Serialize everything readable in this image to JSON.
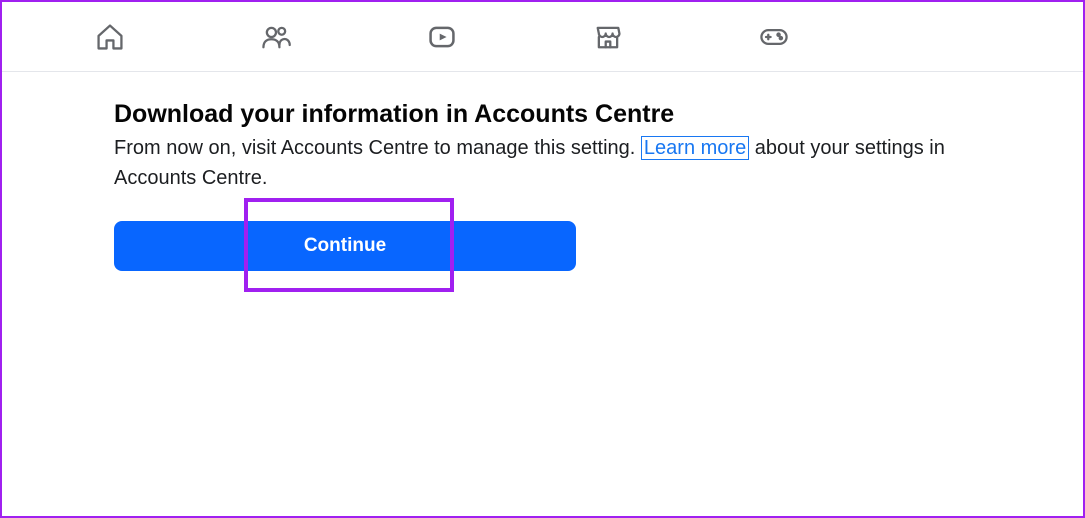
{
  "nav": {
    "home": "home-icon",
    "friends": "friends-icon",
    "video": "video-icon",
    "marketplace": "marketplace-icon",
    "gaming": "gaming-icon"
  },
  "page": {
    "title": "Download your information in Accounts Centre",
    "desc_before": "From now on, visit Accounts Centre to manage this setting. ",
    "learn_more": "Learn more",
    "desc_after": " about your settings in Accounts Centre.",
    "continue": "Continue"
  }
}
